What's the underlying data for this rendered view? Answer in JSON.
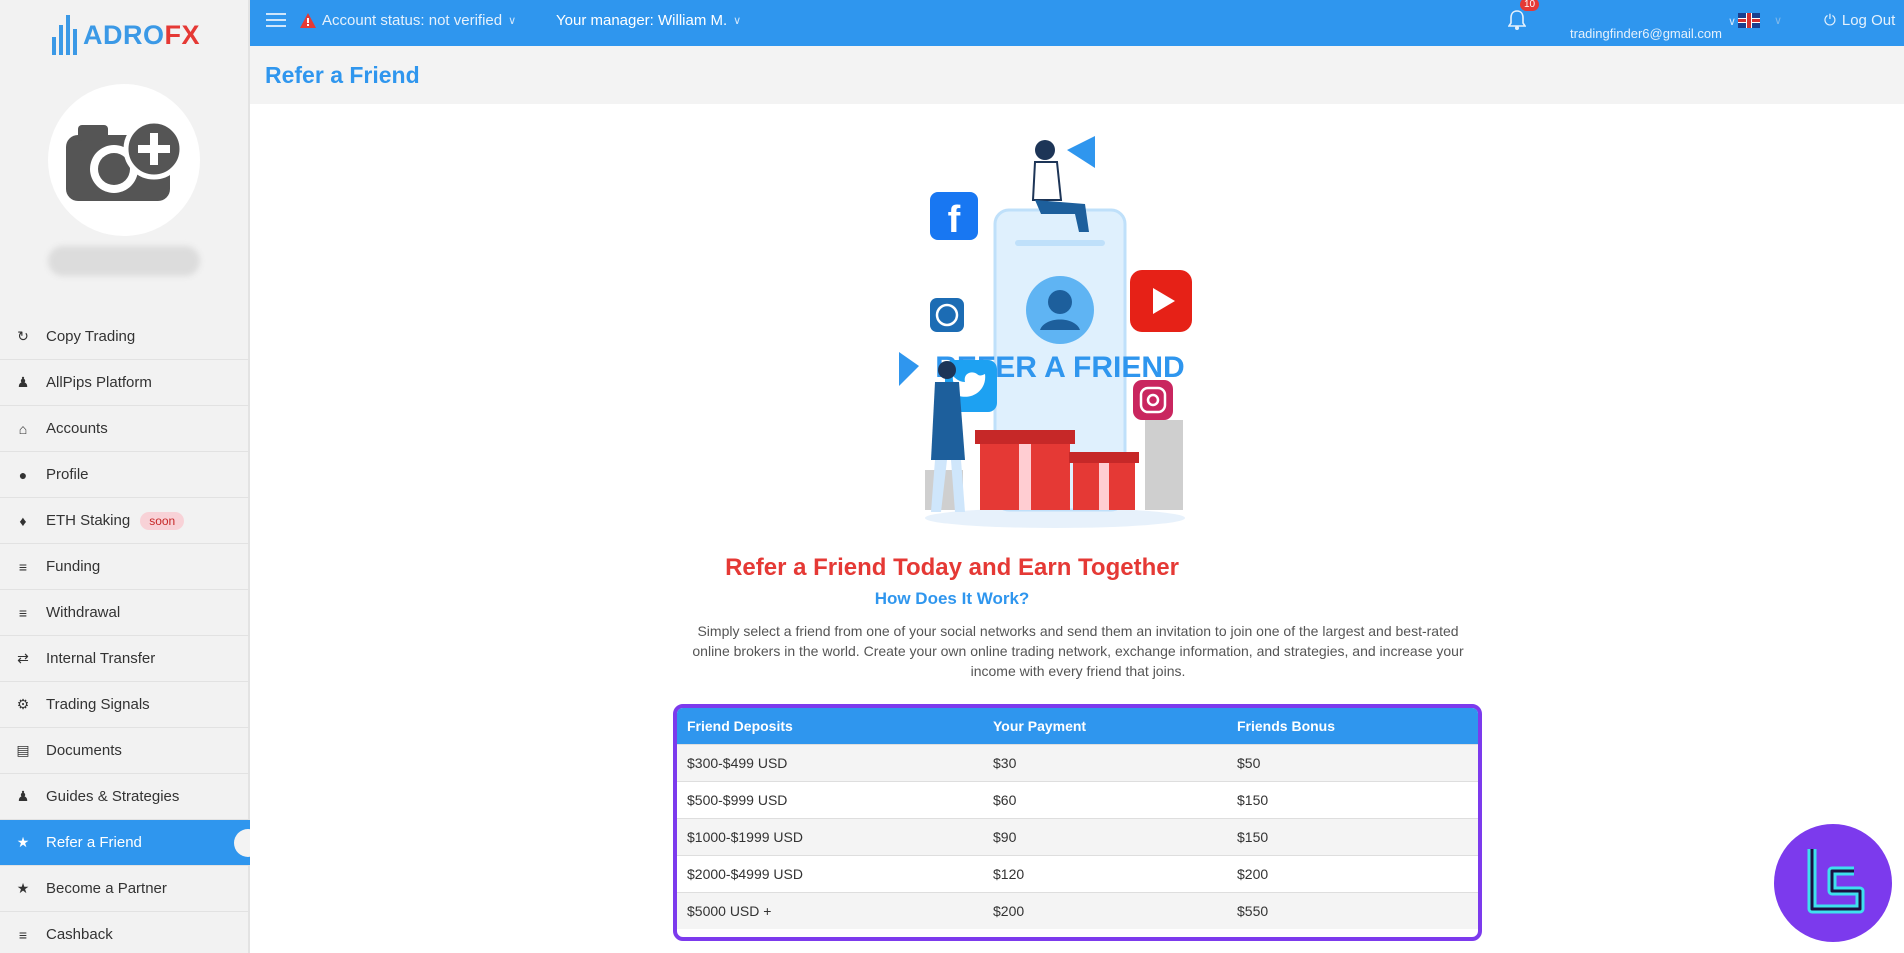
{
  "brand": {
    "part1": "ADRO",
    "part2": "FX",
    "colors": {
      "blue": "#3b99e6",
      "red": "#e53935"
    }
  },
  "sidebar": {
    "avatar_icon": "camera-plus-icon",
    "items": [
      {
        "label": "Copy Trading",
        "icon": "copy-trading-icon"
      },
      {
        "label": "AllPips Platform",
        "icon": "platform-icon"
      },
      {
        "label": "Accounts",
        "icon": "home-icon"
      },
      {
        "label": "Profile",
        "icon": "user-icon"
      },
      {
        "label": "ETH Staking",
        "icon": "ethereum-icon",
        "badge": "soon"
      },
      {
        "label": "Funding",
        "icon": "coins-icon"
      },
      {
        "label": "Withdrawal",
        "icon": "coins-icon"
      },
      {
        "label": "Internal Transfer",
        "icon": "transfer-icon"
      },
      {
        "label": "Trading Signals",
        "icon": "signals-icon"
      },
      {
        "label": "Documents",
        "icon": "document-icon"
      },
      {
        "label": "Guides & Strategies",
        "icon": "guide-icon"
      },
      {
        "label": "Refer a Friend",
        "icon": "refer-icon",
        "active": true
      },
      {
        "label": "Become a Partner",
        "icon": "partner-icon"
      },
      {
        "label": "Cashback",
        "icon": "cashback-icon"
      }
    ]
  },
  "topbar": {
    "account_status": "Account status: not verified",
    "manager": "Your manager: William M.",
    "notifications_count": "10",
    "email": "tradingfinder6@gmail.com",
    "logout": "Log Out",
    "accent": "#2f96ee"
  },
  "page": {
    "title": "Refer a Friend",
    "illustration_text": "REFER A FRIEND",
    "headline": "Refer a Friend Today and Earn Together",
    "subhead": "How Does It Work?",
    "description": "Simply select a friend from one of your social networks and send them an invitation to join one of the largest and best-rated online brokers in the world. Create your own online trading network, exchange information, and strategies, and increase your income with every friend that joins."
  },
  "table": {
    "headers": [
      "Friend Deposits",
      "Your Payment",
      "Friends Bonus"
    ],
    "rows": [
      [
        "$300-$499 USD",
        "$30",
        "$50"
      ],
      [
        "$500-$999 USD",
        "$60",
        "$150"
      ],
      [
        "$1000-$1999 USD",
        "$90",
        "$150"
      ],
      [
        "$2000-$4999 USD",
        "$120",
        "$200"
      ],
      [
        "$5000 USD +",
        "$200",
        "$550"
      ]
    ],
    "highlight_color": "#7c3aed"
  },
  "watermark": {
    "icon": "tradingfinder-logo-icon"
  }
}
